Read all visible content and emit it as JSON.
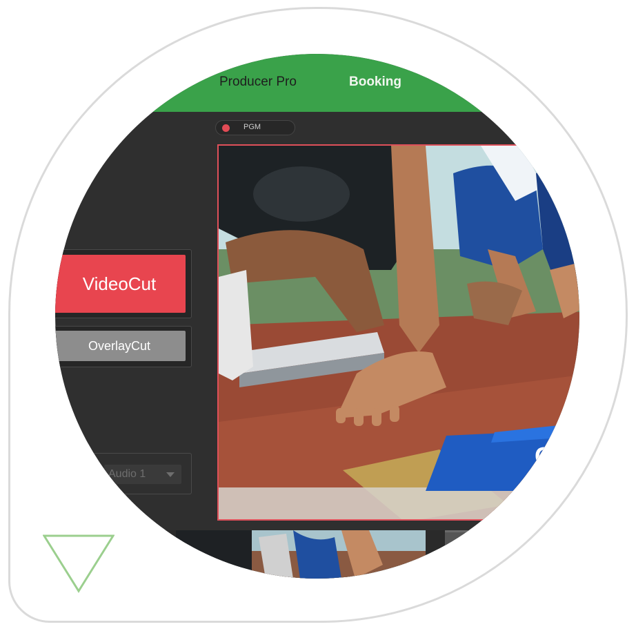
{
  "nav": {
    "producer_pro": "Producer Pro",
    "booking": "Booking"
  },
  "program": {
    "badge_label": "PGM",
    "indicator_color": "#e24b55"
  },
  "controls": {
    "video_cut": "VideoCut",
    "overlay_cut": "OverlayCut",
    "audio_select_value": "Audio 1"
  },
  "overlay_graphic_text": "C",
  "colors": {
    "topbar": "#3aa24a",
    "video_cut": "#e8454f",
    "overlay_cut": "#8d8d8d",
    "program_border": "#e0505a"
  }
}
